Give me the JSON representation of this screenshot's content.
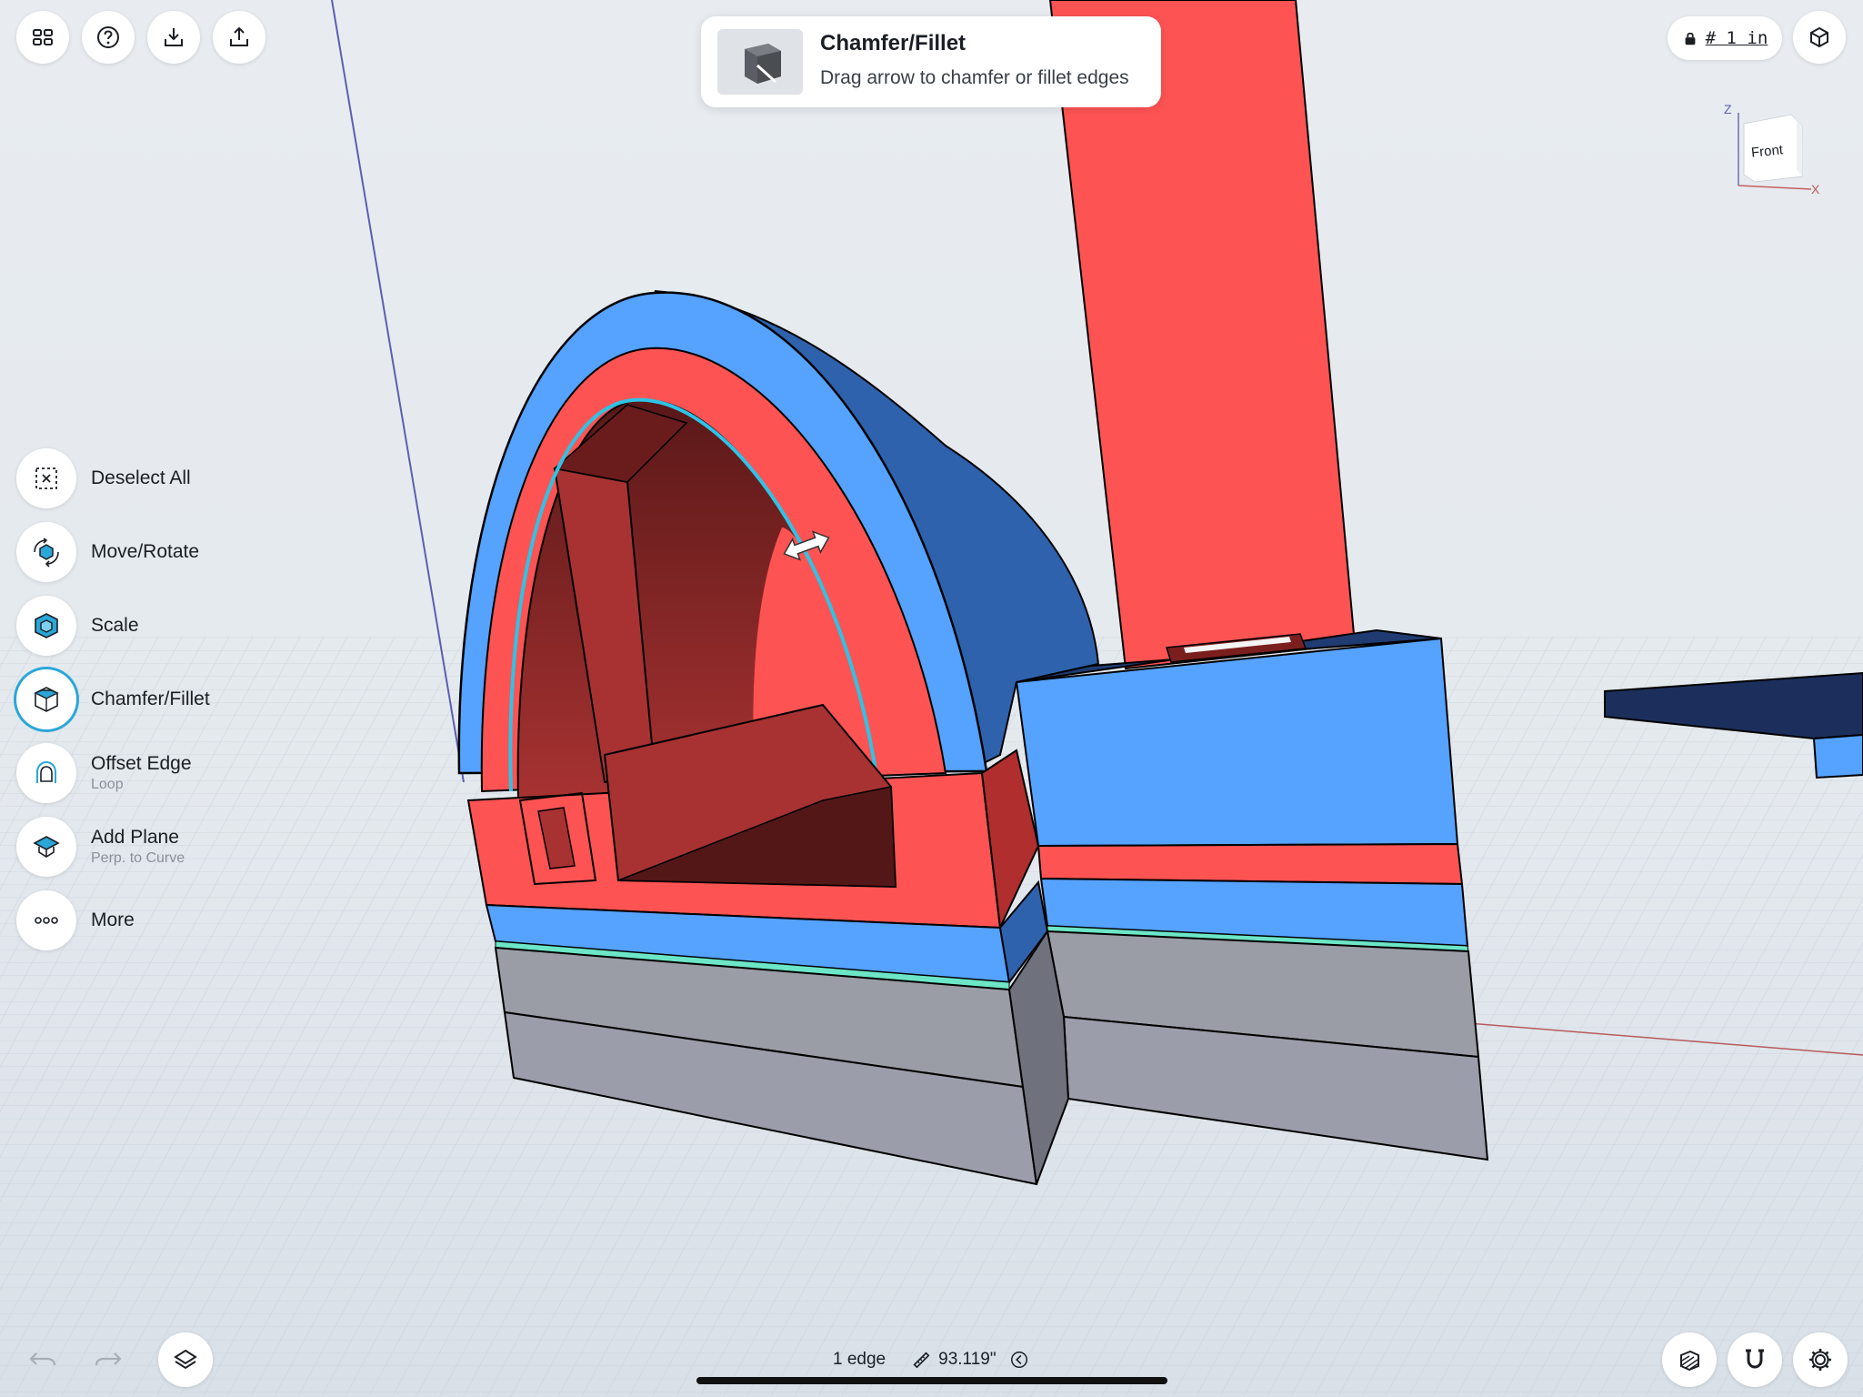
{
  "top_toolbar": {
    "buttons": [
      {
        "icon": "grid-icon"
      },
      {
        "icon": "help-icon"
      },
      {
        "icon": "import-icon"
      },
      {
        "icon": "export-icon"
      }
    ]
  },
  "hint": {
    "title": "Chamfer/Fillet",
    "text": "Drag arrow to chamfer or fillet edges"
  },
  "units": {
    "lock_icon": "lock-icon",
    "label": "# 1 in"
  },
  "view_cube": {
    "face_label": "Front",
    "axis_z": "Z",
    "axis_x": "X"
  },
  "tools": [
    {
      "name": "Deselect All",
      "sub": "",
      "icon": "deselect-icon"
    },
    {
      "name": "Move/Rotate",
      "sub": "",
      "icon": "move-rotate-icon"
    },
    {
      "name": "Scale",
      "sub": "",
      "icon": "scale-icon"
    },
    {
      "name": "Chamfer/Fillet",
      "sub": "",
      "icon": "chamfer-icon",
      "active": true
    },
    {
      "name": "Offset Edge",
      "sub": "Loop",
      "icon": "offset-edge-icon"
    },
    {
      "name": "Add Plane",
      "sub": "Perp. to Curve",
      "icon": "add-plane-icon"
    },
    {
      "name": "More",
      "sub": "",
      "icon": "more-icon"
    }
  ],
  "status": {
    "selection": "1 edge",
    "length": "93.119\""
  },
  "colors": {
    "red_body": "#fe5353",
    "blue_body": "#55a2ff",
    "dark_blue": "#2f62ad",
    "gray_body": "#9a9ca6",
    "selection": "#2ec3e6",
    "accent": "#2aa6d8"
  }
}
